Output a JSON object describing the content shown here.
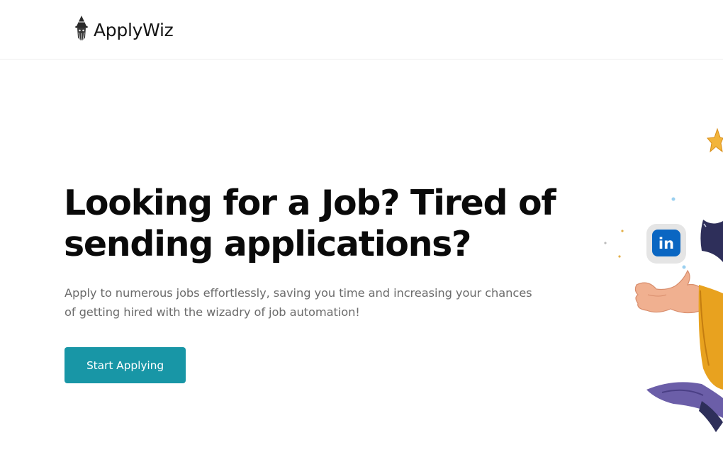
{
  "header": {
    "logo_text": "ApplyWiz"
  },
  "hero": {
    "title_line1": "Looking for a Job? Tired of",
    "title_line2": "sending applications?",
    "subtitle_line1": "Apply to numerous jobs effortlessly, saving you time and increasing your chances",
    "subtitle_line2": "of getting hired with the wizadry of job automation!",
    "cta_label": "Start Applying"
  },
  "illustration": {
    "badge_text": "in",
    "icons": [
      "wizard-logo-icon",
      "linkedin-icon",
      "star-icon",
      "sparkle-icon"
    ]
  },
  "colors": {
    "accent": "#1896a6",
    "linkedin": "#0a66c2",
    "robe": "#e8a21f",
    "star": "#f2b43a"
  }
}
